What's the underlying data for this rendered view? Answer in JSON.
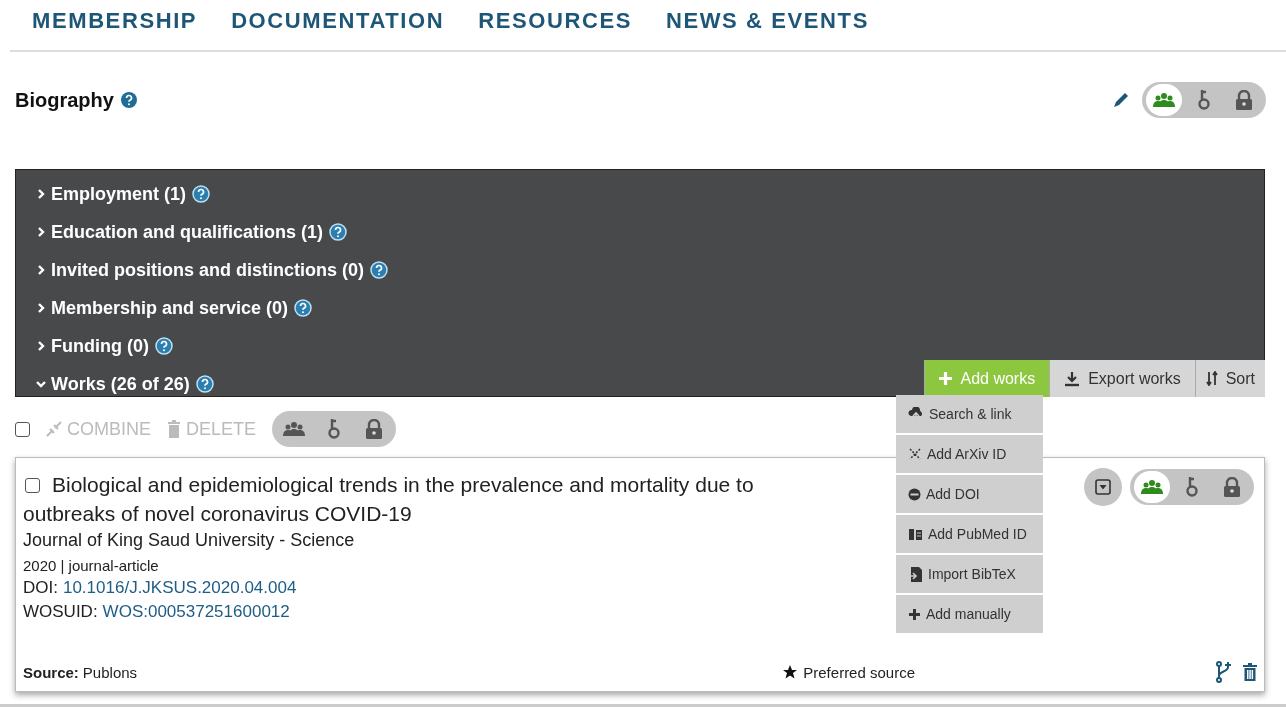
{
  "nav": [
    {
      "label": "MEMBERSHIP"
    },
    {
      "label": "DOCUMENTATION"
    },
    {
      "label": "RESOURCES"
    },
    {
      "label": "NEWS & EVENTS"
    }
  ],
  "biography": {
    "title": "Biography",
    "privacy": [
      {
        "kind": "everyone",
        "selected": true
      },
      {
        "kind": "trusted",
        "selected": false
      },
      {
        "kind": "private",
        "selected": false
      }
    ]
  },
  "sections": [
    {
      "label": "Employment (1)",
      "expanded": false
    },
    {
      "label": "Education and qualifications (1)",
      "expanded": false
    },
    {
      "label": "Invited positions and distinctions (0)",
      "expanded": false
    },
    {
      "label": "Membership and service (0)",
      "expanded": false
    },
    {
      "label": "Funding (0)",
      "expanded": false
    },
    {
      "label": "Works (26 of 26)",
      "expanded": true
    }
  ],
  "works_tabs": [
    {
      "kind": "add",
      "label": "Add works",
      "selected": true
    },
    {
      "kind": "export",
      "label": "Export works",
      "selected": false
    },
    {
      "kind": "sort",
      "label": "Sort",
      "selected": false
    }
  ],
  "add_menu": [
    {
      "kind": "search",
      "label": "Search & link"
    },
    {
      "kind": "arxiv",
      "label": "Add ArXiv ID"
    },
    {
      "kind": "doi",
      "label": "Add DOI"
    },
    {
      "kind": "pubmed",
      "label": "Add PubMed ID"
    },
    {
      "kind": "bibtex",
      "label": "Import BibTeX"
    },
    {
      "kind": "manual",
      "label": "Add manually"
    }
  ],
  "toolbar": {
    "select_all": {
      "checked": false
    },
    "actions": [
      {
        "kind": "combine",
        "label": "COMBINE",
        "disabled": true
      },
      {
        "kind": "delete",
        "label": "DELETE",
        "disabled": true
      }
    ],
    "privacy": [
      {
        "kind": "everyone",
        "selected": false
      },
      {
        "kind": "trusted",
        "selected": false
      },
      {
        "kind": "private",
        "selected": false
      }
    ]
  },
  "work": {
    "checked": false,
    "title": "Biological and epidemiological trends in the prevalence and mortality due to outbreaks of novel coronavirus COVID-19",
    "journal": "Journal of King Saud University - Science",
    "meta": "2020 | journal-article",
    "identifiers": [
      {
        "label": "DOI:",
        "value": "10.1016/J.JKSUS.2020.04.004"
      },
      {
        "label": "WOSUID:",
        "value": "WOS:000537251600012"
      }
    ],
    "privacy": [
      {
        "kind": "everyone",
        "selected": true
      },
      {
        "kind": "trusted",
        "selected": false
      },
      {
        "kind": "private",
        "selected": false
      }
    ],
    "source_label": "Source:",
    "source": "Publons",
    "preferred": "Preferred source"
  }
}
